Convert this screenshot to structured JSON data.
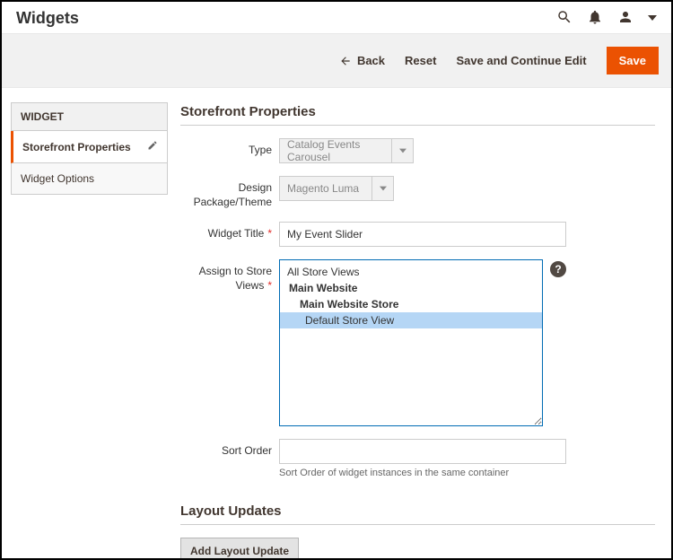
{
  "header": {
    "title": "Widgets"
  },
  "actions": {
    "back": "Back",
    "reset": "Reset",
    "save_continue": "Save and Continue Edit",
    "save": "Save"
  },
  "sidebar": {
    "section_title": "WIDGET",
    "items": [
      {
        "label": "Storefront Properties",
        "active": true
      },
      {
        "label": "Widget Options",
        "active": false
      }
    ]
  },
  "section1_title": "Storefront Properties",
  "fields": {
    "type": {
      "label": "Type",
      "value": "Catalog Events Carousel"
    },
    "theme": {
      "label": "Design Package/Theme",
      "value": "Magento Luma"
    },
    "title": {
      "label": "Widget Title",
      "value": "My Event Slider"
    },
    "assign": {
      "label": "Assign to Store Views"
    },
    "sort": {
      "label": "Sort Order",
      "value": "",
      "hint": "Sort Order of widget instances in the same container"
    }
  },
  "store_views": {
    "all": "All Store Views",
    "website": "Main Website",
    "store": "Main Website Store",
    "view": "Default Store View"
  },
  "section2_title": "Layout Updates",
  "add_layout_btn": "Add Layout Update"
}
